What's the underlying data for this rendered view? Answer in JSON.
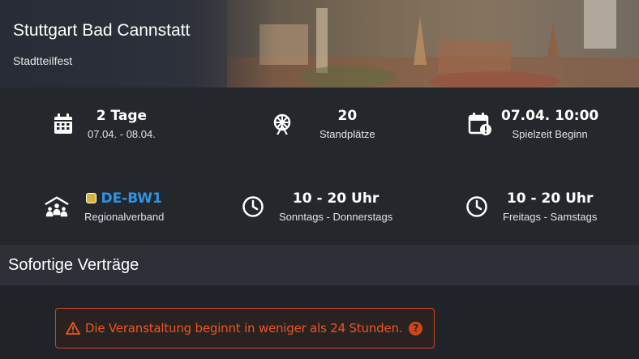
{
  "hero": {
    "title": "Stuttgart Bad Cannstatt",
    "subtitle": "Stadtteilfest"
  },
  "stats": [
    {
      "icon": "calendar-icon",
      "main": "2 Tage",
      "sub": "07.04. - 08.04."
    },
    {
      "icon": "ferris-wheel-icon",
      "main": "20",
      "sub": "Standplätze"
    },
    {
      "icon": "calendar-alert-icon",
      "main": "07.04. 10:00",
      "sub": "Spielzeit Beginn"
    },
    {
      "icon": "people-group-icon",
      "main": "DE-BW1",
      "sub": "Regionalverband"
    },
    {
      "icon": "clock-icon",
      "main": "10 - 20 Uhr",
      "sub": "Sonntags - Donnerstags"
    },
    {
      "icon": "clock-icon",
      "main": "10 - 20 Uhr",
      "sub": "Freitags - Samstags"
    }
  ],
  "section": {
    "title": "Sofortige Verträge"
  },
  "alert": {
    "text": "Die Veranstaltung beginnt in weniger als 24 Stunden.",
    "help": "?"
  },
  "colors": {
    "accent": "#2e95e6",
    "warning": "#ee5522",
    "badge": "#d8b43a"
  }
}
